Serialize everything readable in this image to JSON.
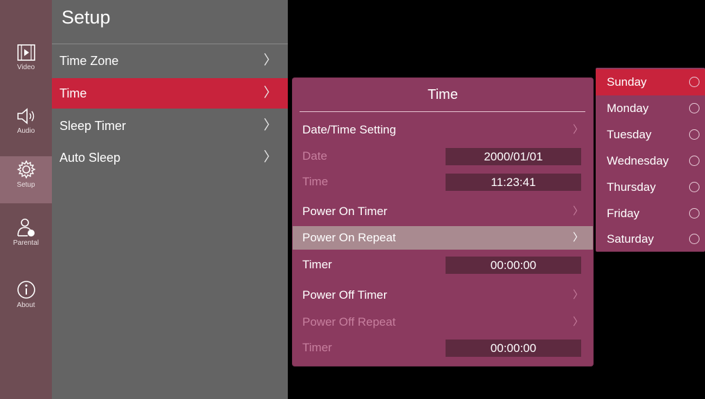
{
  "sidebar": {
    "items": [
      {
        "label": "Video",
        "icon": "video-icon"
      },
      {
        "label": "Audio",
        "icon": "speaker-icon"
      },
      {
        "label": "Setup",
        "icon": "gear-icon"
      },
      {
        "label": "Parental",
        "icon": "parental-lock-icon"
      },
      {
        "label": "About",
        "icon": "info-icon"
      }
    ],
    "active": "Setup"
  },
  "menu": {
    "title": "Setup",
    "items": [
      {
        "label": "Time Zone",
        "chevron": "〉"
      },
      {
        "label": "Time",
        "chevron": "〉"
      },
      {
        "label": "Sleep Timer",
        "chevron": "〉"
      },
      {
        "label": "Auto Sleep",
        "chevron": "〉"
      }
    ],
    "active": "Time"
  },
  "time_panel": {
    "title": "Time",
    "date_time_setting": "Date/Time Setting",
    "date_label": "Date",
    "date_value": "2000/01/01",
    "time_label": "Time",
    "time_value": "11:23:41",
    "power_on_timer": "Power On Timer",
    "power_on_repeat": "Power On Repeat",
    "timer_label_1": "Timer",
    "timer_value_1": "00:00:00",
    "power_off_timer": "Power Off Timer",
    "power_off_repeat": "Power Off Repeat",
    "timer_label_2": "Timer",
    "timer_value_2": "00:00:00",
    "chevron": "〉"
  },
  "days": {
    "items": [
      "Sunday",
      "Monday",
      "Tuesday",
      "Wednesday",
      "Thursday",
      "Friday",
      "Saturday"
    ],
    "active": "Sunday"
  },
  "colors": {
    "accent": "#c8233c",
    "panel": "#8b3a5f",
    "menu_bg": "#646464",
    "rail_bg": "#6e4d54"
  }
}
